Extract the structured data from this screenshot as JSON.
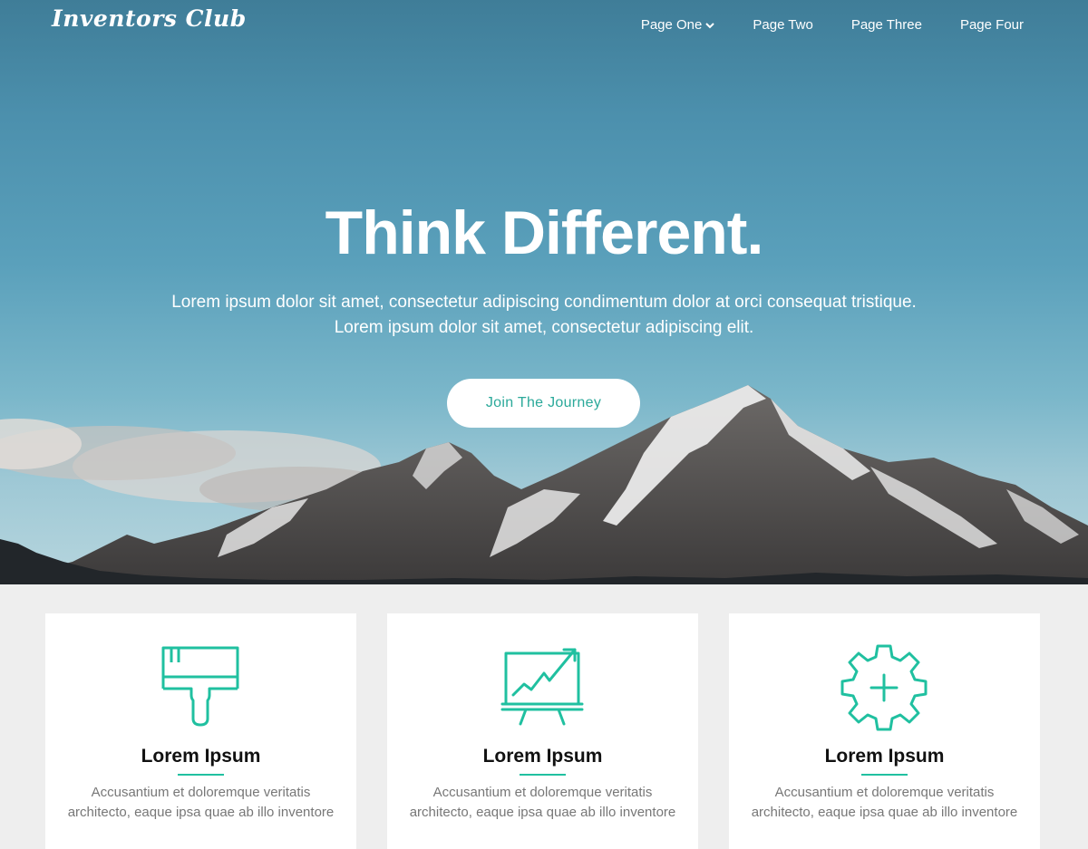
{
  "brand": {
    "logo_text": "Inventors Club"
  },
  "nav": {
    "items": [
      {
        "label": "Page One",
        "icon": "chevron-down-icon"
      },
      {
        "label": "Page Two"
      },
      {
        "label": "Page Three"
      },
      {
        "label": "Page Four"
      }
    ]
  },
  "hero": {
    "title": "Think Different.",
    "subtitle_line1": "Lorem ipsum dolor sit amet, consectetur adipiscing condimentum dolor at orci consequat tristique.",
    "subtitle_line2": "Lorem ipsum dolor sit amet, consectetur adipiscing elit.",
    "cta_label": "Join The Journey"
  },
  "features": [
    {
      "icon": "paint-brush-icon",
      "title": "Lorem Ipsum",
      "text": "Accusantium et doloremque veritatis architecto, eaque ipsa quae ab illo inventore"
    },
    {
      "icon": "chart-presentation-icon",
      "title": "Lorem Ipsum",
      "text": "Accusantium et doloremque veritatis architecto, eaque ipsa quae ab illo inventore"
    },
    {
      "icon": "gear-plus-icon",
      "title": "Lorem Ipsum",
      "text": "Accusantium et doloremque veritatis architecto, eaque ipsa quae ab illo inventore"
    }
  ],
  "colors": {
    "accent": "#20c0a0",
    "cta_text": "#2ba99a",
    "page_bg": "#eeeeee",
    "card_bg": "#ffffff"
  }
}
